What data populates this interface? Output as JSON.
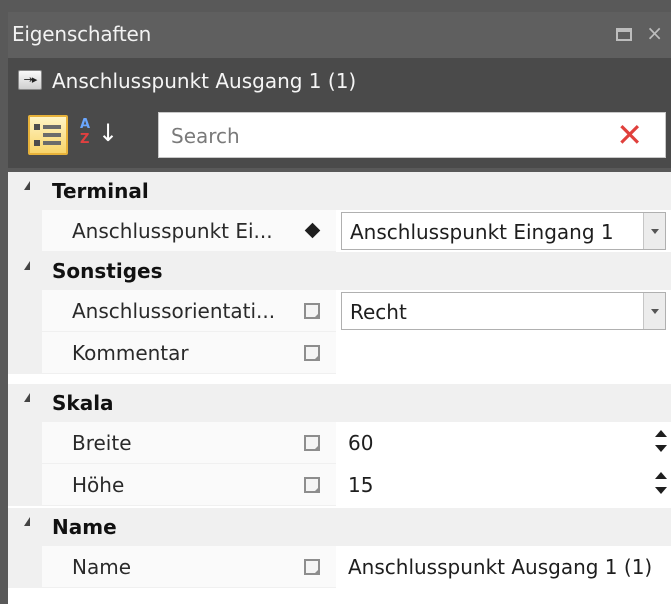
{
  "panel": {
    "title": "Eigenschaften",
    "window_buttons": {
      "maximize_icon": "maximize-icon",
      "close_label": "×"
    }
  },
  "selection": {
    "icon": "connector-output-icon",
    "icon_glyph": "→▸",
    "name": "Anschlusspunkt Ausgang 1 (1)"
  },
  "toolbar": {
    "categorized_icon": "categorized-view-icon",
    "alphabetical_icon": "sort-alphabetical-icon",
    "search": {
      "placeholder": "Search",
      "value": ""
    },
    "clear_label": "✕"
  },
  "categories": [
    {
      "label": "Terminal",
      "rows": [
        {
          "name": "Anschlusspunkt Ei...",
          "marker": "diamond-icon",
          "value": "Anschlusspunkt Eingang 1",
          "editor": "combo"
        }
      ]
    },
    {
      "label": "Sonstiges",
      "rows": [
        {
          "name": "Anschlussorientati...",
          "marker": "edit-icon",
          "value": "Recht",
          "editor": "combo"
        },
        {
          "name": "Kommentar",
          "marker": "edit-icon",
          "value": "",
          "editor": "text"
        }
      ]
    },
    {
      "label": "Skala",
      "rows": [
        {
          "name": "Breite",
          "marker": "edit-icon",
          "value": "60",
          "editor": "spin"
        },
        {
          "name": "Höhe",
          "marker": "edit-icon",
          "value": "15",
          "editor": "spin"
        }
      ]
    },
    {
      "label": "Name",
      "rows": [
        {
          "name": "Name",
          "marker": "edit-icon",
          "value": "Anschlusspunkt Ausgang 1 (1)",
          "editor": "text"
        }
      ]
    }
  ],
  "colors": {
    "panel_bg": "#4a4a4a",
    "title_bg": "#5f5f5f",
    "category_bg": "#f0f0f0",
    "accent_selected": "#f8d46a",
    "clear_red": "#e0403c"
  }
}
